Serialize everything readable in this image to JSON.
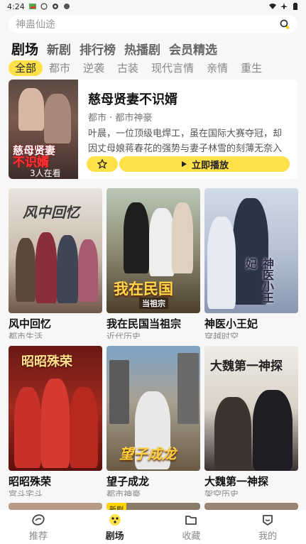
{
  "status_bar": {
    "time": "4:24"
  },
  "search": {
    "placeholder": "神蛊仙途"
  },
  "main_tabs": [
    {
      "label": "剧场",
      "active": true
    },
    {
      "label": "新剧"
    },
    {
      "label": "排行榜"
    },
    {
      "label": "热播剧"
    },
    {
      "label": "会员精选"
    }
  ],
  "categories": [
    {
      "label": "全部",
      "active": true
    },
    {
      "label": "都市"
    },
    {
      "label": "逆袭"
    },
    {
      "label": "古装"
    },
    {
      "label": "现代言情"
    },
    {
      "label": "亲情"
    },
    {
      "label": "重生"
    }
  ],
  "featured": {
    "title": "慈母贤妻不识婿",
    "tags": "都市 · 都市神豪",
    "description": "叶晨，一位顶级电焊工，虽在国际大赛夺冠，却因丈母娘蒋春花的强势与妻子林雪的刻薄无奈入赘。",
    "poster_title_line1": "慈母贤妻",
    "poster_title_line2": "不识婿",
    "viewers": "3人在看",
    "play_label": "立即播放"
  },
  "dramas": [
    {
      "title": "风中回忆",
      "subtitle": "都市生活",
      "poster_text": "风中回忆"
    },
    {
      "title": "我在民国当祖宗",
      "subtitle": "近代历史",
      "poster_text": "我在民国",
      "poster_subtext": "当祖宗"
    },
    {
      "title": "神医小王妃",
      "subtitle": "穿越时空",
      "poster_text": "神医小王妃"
    },
    {
      "title": "昭昭殊荣",
      "subtitle": "宫斗宅斗",
      "poster_text": "昭昭殊荣"
    },
    {
      "title": "望子成龙",
      "subtitle": "都市神豪",
      "poster_text": "望子成龙"
    },
    {
      "title": "大魏第一神探",
      "subtitle": "架空历史",
      "poster_text": "大魏第一神探"
    }
  ],
  "partial_row": {
    "new_badge": "新剧"
  },
  "bottom_nav": [
    {
      "label": "推荐",
      "icon": "recommend-icon"
    },
    {
      "label": "剧场",
      "icon": "theater-icon",
      "active": true
    },
    {
      "label": "收藏",
      "icon": "favorites-icon"
    },
    {
      "label": "我的",
      "icon": "profile-icon"
    }
  ],
  "colors": {
    "accent": "#ffe14a",
    "background": "#f7f7f7"
  }
}
